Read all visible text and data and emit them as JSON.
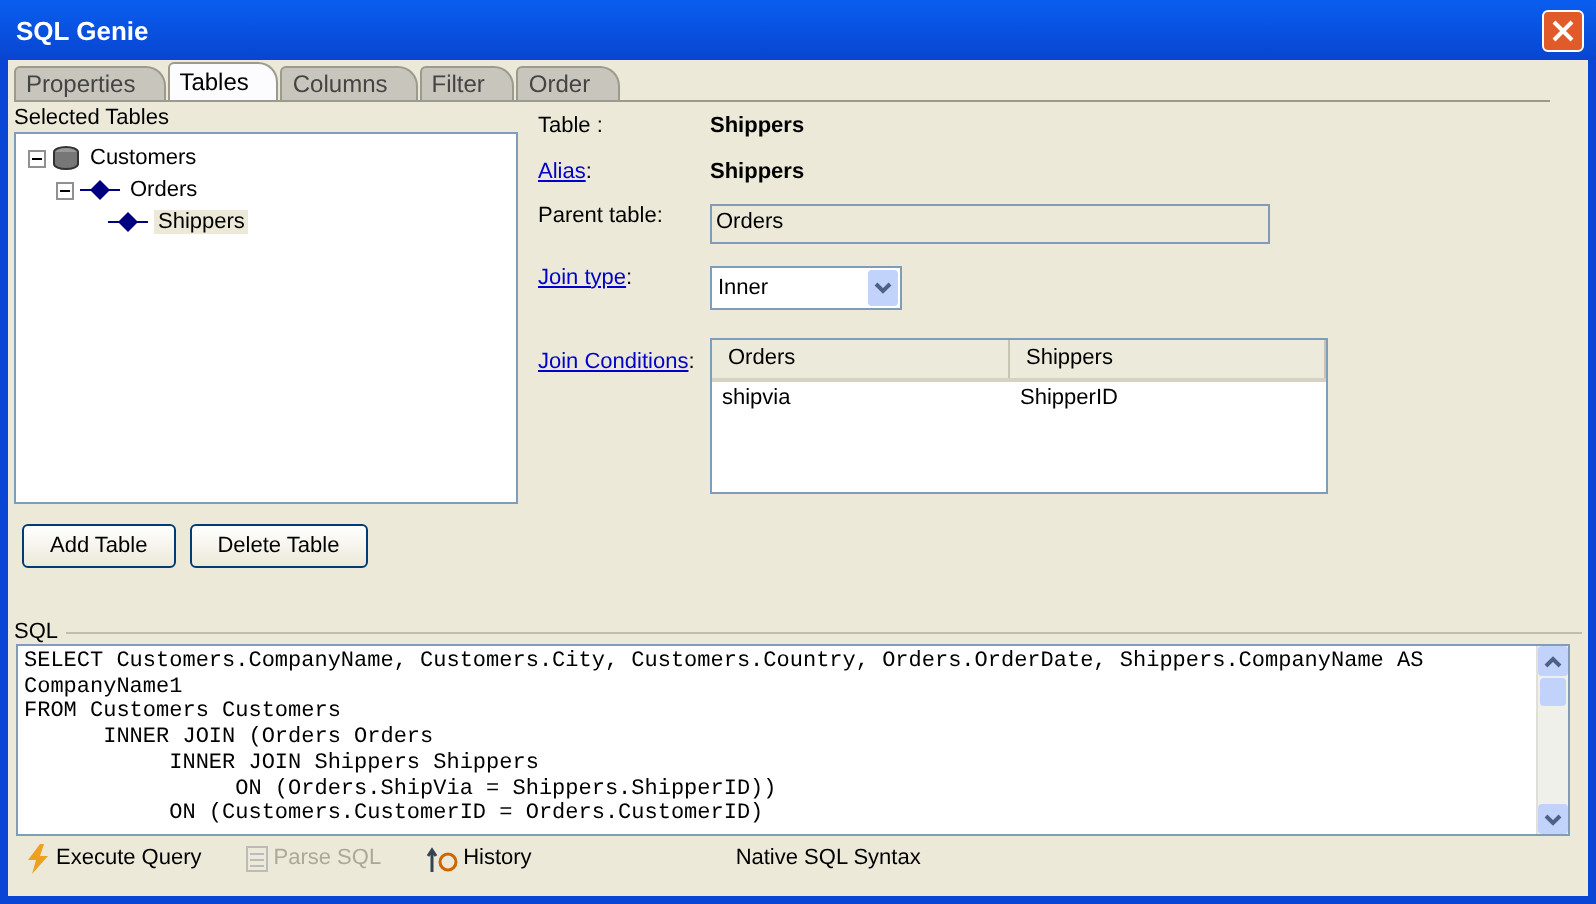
{
  "window": {
    "title": "SQL Genie"
  },
  "tabs": [
    {
      "label": "Properties",
      "selected": false
    },
    {
      "label": "Tables",
      "selected": true
    },
    {
      "label": "Columns",
      "selected": false
    },
    {
      "label": "Filter",
      "selected": false
    },
    {
      "label": "Order",
      "selected": false
    }
  ],
  "tree": {
    "title": "Selected Tables",
    "items": [
      {
        "label": "Customers",
        "kind": "database",
        "expanded": true,
        "selected": false,
        "children": [
          {
            "label": "Orders",
            "kind": "table",
            "expanded": true,
            "selected": false,
            "children": [
              {
                "label": "Shippers",
                "kind": "table",
                "selected": true
              }
            ]
          }
        ]
      }
    ]
  },
  "properties": {
    "table_label": "Table :",
    "table_value": "Shippers",
    "alias_label": "Alias",
    "alias_value": "Shippers",
    "parent_label": "Parent table:",
    "parent_value": "Orders",
    "join_type_label": "Join type",
    "join_type_value": "Inner",
    "join_conditions_label": "Join Conditions",
    "colon": ":"
  },
  "join_conditions": {
    "columns": [
      "Orders",
      "Shippers"
    ],
    "rows": [
      [
        "shipvia",
        "ShipperID"
      ]
    ]
  },
  "buttons": [
    "Add Table",
    "Delete Table"
  ],
  "sql": {
    "label": "SQL",
    "lines": [
      "SELECT Customers.CompanyName, Customers.City, Customers.Country, Orders.OrderDate, Shippers.CompanyName AS",
      "CompanyName1",
      "FROM Customers Customers",
      "      INNER JOIN (Orders Orders",
      "           INNER JOIN Shippers Shippers",
      "                ON (Orders.ShipVia = Shippers.ShipperID))",
      "           ON (Customers.CustomerID = Orders.CustomerID)"
    ]
  },
  "toolbar": [
    {
      "label": "Execute Query",
      "kind": "bolt",
      "disabled": false
    },
    {
      "label": "Parse SQL",
      "kind": "parse",
      "disabled": true
    },
    {
      "label": "History",
      "kind": "history",
      "disabled": false
    }
  ],
  "status": "Native SQL Syntax"
}
